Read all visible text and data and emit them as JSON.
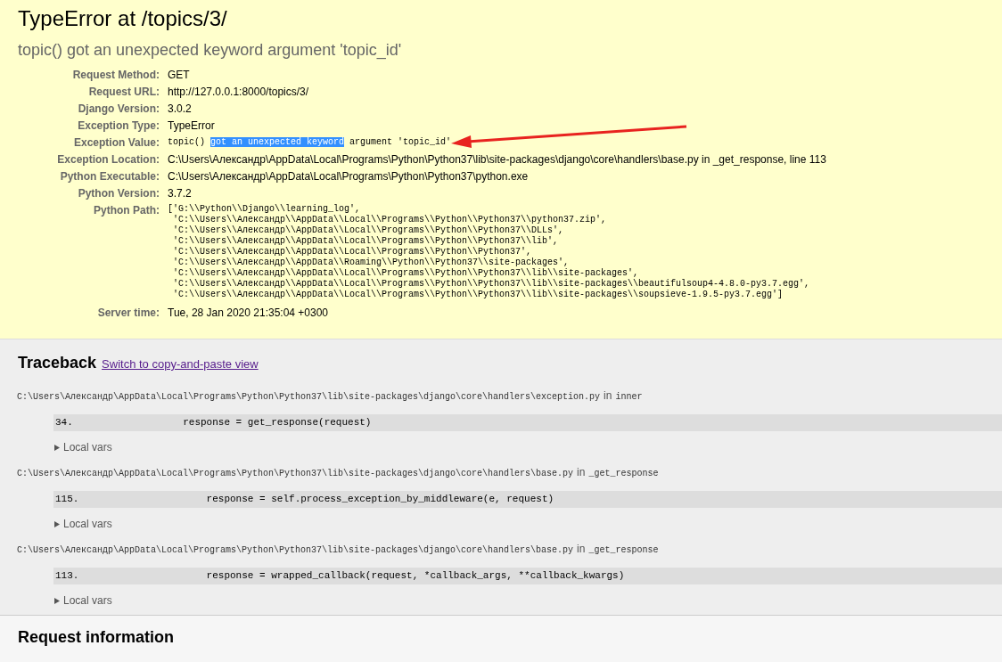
{
  "summary": {
    "title": "TypeError at /topics/3/",
    "subtitle": "topic() got an unexpected keyword argument 'topic_id'",
    "meta": [
      {
        "label": "Request Method:",
        "kind": "text",
        "value": "GET"
      },
      {
        "label": "Request URL:",
        "kind": "text",
        "value": "http://127.0.0.1:8000/topics/3/"
      },
      {
        "label": "Django Version:",
        "kind": "text",
        "value": "3.0.2"
      },
      {
        "label": "Exception Type:",
        "kind": "text",
        "value": "TypeError"
      },
      {
        "label": "Exception Value:",
        "kind": "selection",
        "before": "topic() ",
        "selected": "got an unexpected keyword",
        "after": " argument 'topic_id'"
      },
      {
        "label": "Exception Location:",
        "kind": "text",
        "value": "C:\\Users\\Александр\\AppData\\Local\\Programs\\Python\\Python37\\lib\\site-packages\\django\\core\\handlers\\base.py in _get_response, line 113"
      },
      {
        "label": "Python Executable:",
        "kind": "text",
        "value": "C:\\Users\\Александр\\AppData\\Local\\Programs\\Python\\Python37\\python.exe"
      },
      {
        "label": "Python Version:",
        "kind": "text",
        "value": "3.7.2"
      },
      {
        "label": "Python Path:",
        "kind": "lines",
        "lines": [
          "['G:\\\\Python\\\\Django\\\\learning_log',",
          " 'C:\\\\Users\\\\Александр\\\\AppData\\\\Local\\\\Programs\\\\Python\\\\Python37\\\\python37.zip',",
          " 'C:\\\\Users\\\\Александр\\\\AppData\\\\Local\\\\Programs\\\\Python\\\\Python37\\\\DLLs',",
          " 'C:\\\\Users\\\\Александр\\\\AppData\\\\Local\\\\Programs\\\\Python\\\\Python37\\\\lib',",
          " 'C:\\\\Users\\\\Александр\\\\AppData\\\\Local\\\\Programs\\\\Python\\\\Python37',",
          " 'C:\\\\Users\\\\Александр\\\\AppData\\\\Roaming\\\\Python\\\\Python37\\\\site-packages',",
          " 'C:\\\\Users\\\\Александр\\\\AppData\\\\Local\\\\Programs\\\\Python\\\\Python37\\\\lib\\\\site-packages',",
          " 'C:\\\\Users\\\\Александр\\\\AppData\\\\Local\\\\Programs\\\\Python\\\\Python37\\\\lib\\\\site-packages\\\\beautifulsoup4-4.8.0-py3.7.egg',",
          " 'C:\\\\Users\\\\Александр\\\\AppData\\\\Local\\\\Programs\\\\Python\\\\Python37\\\\lib\\\\site-packages\\\\soupsieve-1.9.5-py3.7.egg']"
        ]
      },
      {
        "label": "Server time:",
        "kind": "text",
        "value": "Tue, 28 Jan 2020 21:35:04 +0300"
      }
    ]
  },
  "traceback": {
    "title": "Traceback",
    "switch_link": "Switch to copy-and-paste view",
    "frames": [
      {
        "file": "C:\\Users\\Александр\\AppData\\Local\\Programs\\Python\\Python37\\lib\\site-packages\\django\\core\\handlers\\exception.py",
        "in": "in",
        "function": "inner",
        "line_no": "34.",
        "code": "            response = get_response(request)",
        "vars_label": "Local vars",
        "expanded": false
      },
      {
        "file": "C:\\Users\\Александр\\AppData\\Local\\Programs\\Python\\Python37\\lib\\site-packages\\django\\core\\handlers\\base.py",
        "in": "in",
        "function": "_get_response",
        "line_no": "115.",
        "code": "                response = self.process_exception_by_middleware(e, request)",
        "vars_label": "Local vars",
        "expanded": false
      },
      {
        "file": "C:\\Users\\Александр\\AppData\\Local\\Programs\\Python\\Python37\\lib\\site-packages\\django\\core\\handlers\\base.py",
        "in": "in",
        "function": "_get_response",
        "line_no": "113.",
        "code": "                response = wrapped_callback(request, *callback_args, **callback_kwargs)",
        "vars_label": "Local vars",
        "expanded": false
      }
    ]
  },
  "request_info": {
    "title": "Request information"
  }
}
